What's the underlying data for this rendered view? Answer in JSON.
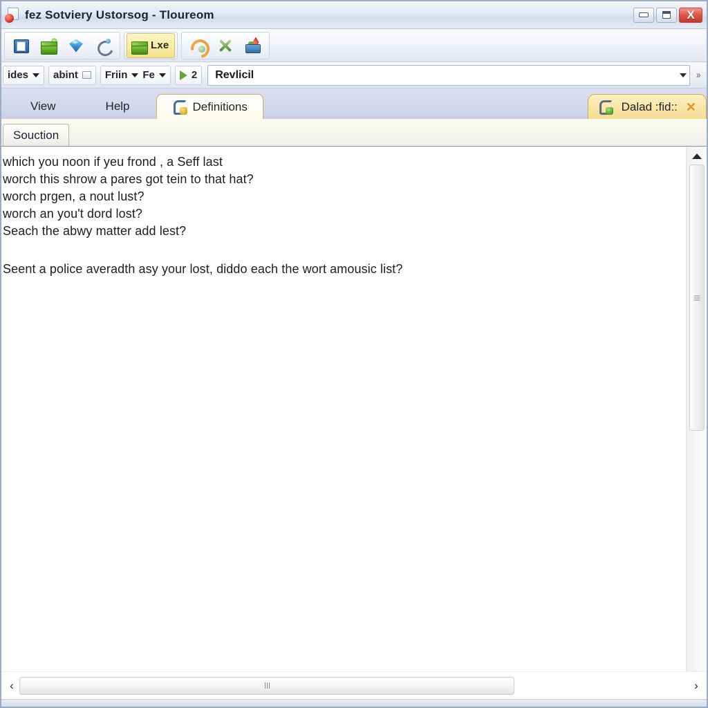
{
  "window": {
    "title": "fez Sotviery Ustorsog  -  Tloureom",
    "app_icon": "document-app-icon",
    "controls": {
      "minimize": "–",
      "maximize": "□",
      "close": "X"
    }
  },
  "toolbar_primary": {
    "groups": [
      {
        "buttons": [
          {
            "icon": "window-icon",
            "label": ""
          },
          {
            "icon": "green-box-icon",
            "label": ""
          },
          {
            "icon": "blue-diamond-icon",
            "label": ""
          },
          {
            "icon": "swirl-icon",
            "label": ""
          }
        ]
      },
      {
        "buttons": [
          {
            "icon": "green-package-icon",
            "label": "Lxe",
            "active": true
          }
        ]
      },
      {
        "buttons": [
          {
            "icon": "orange-loop-icon",
            "label": ""
          },
          {
            "icon": "green-cross-tools-icon",
            "label": ""
          },
          {
            "icon": "paint-plant-icon",
            "label": ""
          }
        ]
      }
    ]
  },
  "toolbar_secondary": {
    "combo_ides": "ides",
    "combo_abint": "abint",
    "combo_frin": "Friin",
    "combo_fe": "Fe",
    "go_count": "2",
    "address_value": "Revlicil",
    "address_placeholder": "Revlicil",
    "overflow_chevron": "»"
  },
  "tabs": {
    "items": [
      {
        "label": "View",
        "active": false,
        "icon": ""
      },
      {
        "label": "Help",
        "active": false,
        "icon": ""
      },
      {
        "label": "Definitions",
        "active": true,
        "icon": "definitions-tab-icon"
      }
    ],
    "right_tab": {
      "label": "Dalad :fid::",
      "icon": "dalad-tab-icon",
      "close": "✕"
    }
  },
  "subtabs": {
    "items": [
      {
        "label": "Souction",
        "active": true
      }
    ]
  },
  "document": {
    "lines": [
      "which you noon if yeu frond , a Seff last",
      "worch this shrow a pares got tein to that hat?",
      "worch prgen, a nout lust?",
      "worch an you't dord lost?",
      "Seach the abwy matter add lest?"
    ],
    "paragraph": "Seent a police averadth asy your lost, diddo each the wort amousic list?"
  },
  "scrollbars": {
    "vertical": {
      "up_arrow": "▲",
      "down_arrow": "▼"
    },
    "horizontal": {
      "left_arrow": "‹",
      "right_arrow": "›"
    }
  },
  "colors": {
    "titlebar": "#e3e8f3",
    "tabstrip": "#d2d6ea",
    "active_tab": "#fffdf2",
    "right_tab": "#f9e6a8",
    "highlight_button": "#f8eda3",
    "close_button": "#e05a4c"
  }
}
